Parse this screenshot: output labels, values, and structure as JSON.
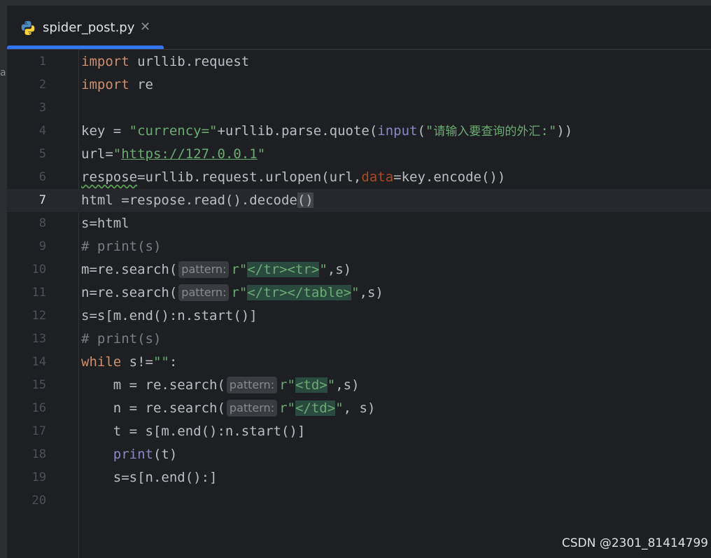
{
  "tab": {
    "filename": "spider_post.py",
    "close_glyph": "✕",
    "icon": "python-icon"
  },
  "sidebar": {
    "letter": "a"
  },
  "lines": [
    "1",
    "2",
    "3",
    "4",
    "5",
    "6",
    "7",
    "8",
    "9",
    "10",
    "11",
    "12",
    "13",
    "14",
    "15",
    "16",
    "17",
    "18",
    "19",
    "20"
  ],
  "current_line": "7",
  "code": {
    "l1": {
      "kw": "import",
      "rest": " urllib.request"
    },
    "l2": {
      "kw": "import",
      "rest": " re"
    },
    "l4": {
      "a": "key = ",
      "str1": "\"currency=\"",
      "b": "+urllib.parse.quote(",
      "bi": "input",
      "c": "(",
      "str2a": "\"",
      "str2_cjk": "请输入要查询的外汇",
      "str2b": ":\"",
      "d": "))"
    },
    "l5": {
      "a": "url=",
      "q1": "\"",
      "link": "https://127.0.0.1",
      "q2": "\""
    },
    "l6": {
      "var": "respose",
      "a": "=urllib.request.urlopen(url,",
      "param": "data",
      "b": "=key.encode())"
    },
    "l7": {
      "a": "html =respose.read().decode",
      "brace": "()"
    },
    "l8": {
      "a": "s=html"
    },
    "l9": {
      "comment": "# print(s)"
    },
    "l10": {
      "a": "m=re.search(",
      "hint": "pattern:",
      "r": "r\"",
      "rx": "</tr><tr>",
      "q": "\"",
      "b": ",s)"
    },
    "l11": {
      "a": "n=re.search(",
      "hint": "pattern:",
      "r": "r\"",
      "rx": "</tr></table>",
      "q": "\"",
      "b": ",s)"
    },
    "l12": {
      "a": "s=s[m.end():n.start()]"
    },
    "l13": {
      "comment": "# print(s)"
    },
    "l14": {
      "kw": "while",
      "a": " s!=",
      "str": "\"\"",
      "b": ":"
    },
    "l15": {
      "a": "    m = re.search(",
      "hint": "pattern:",
      "r": "r\"",
      "rx": "<td>",
      "q": "\"",
      "b": ",s)"
    },
    "l16": {
      "a": "    n = re.search(",
      "hint": "pattern:",
      "r": "r\"",
      "rx": "</td>",
      "q": "\"",
      "b": ", s)"
    },
    "l17": {
      "a": "    t = s[m.end():n.start()]"
    },
    "l18": {
      "indent": "    ",
      "bi": "print",
      "a": "(t)"
    },
    "l19": {
      "a": "    s=s[n.end():]"
    }
  },
  "watermark": "CSDN @2301_81414799"
}
